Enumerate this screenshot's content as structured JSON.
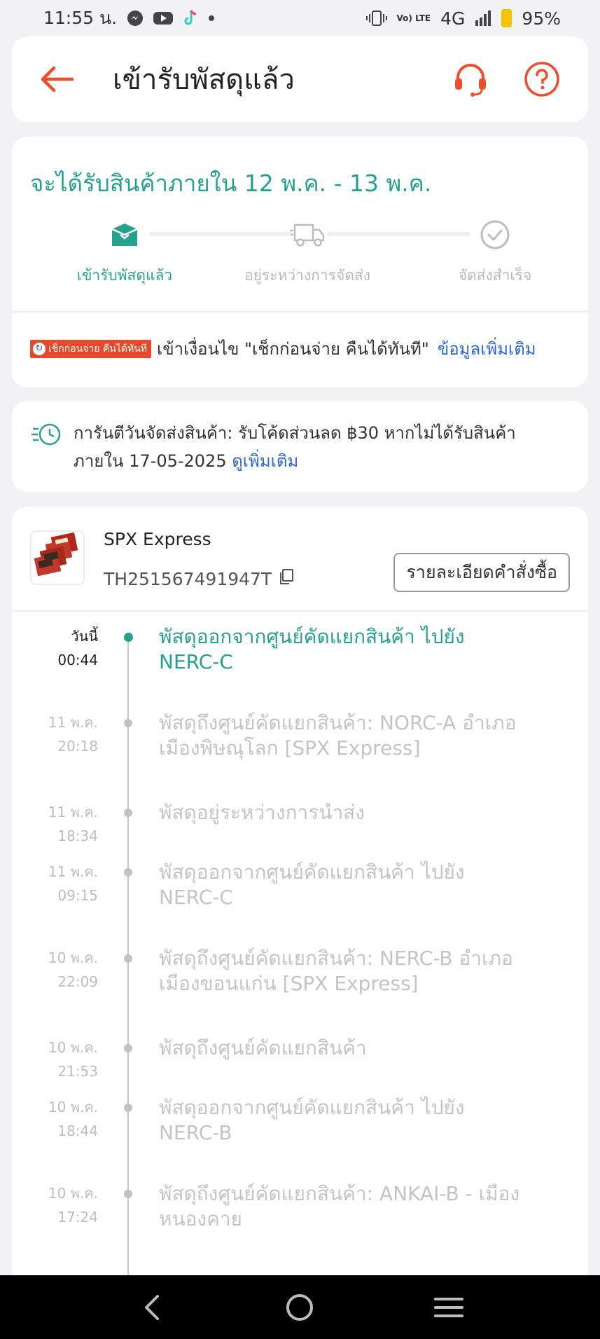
{
  "status_bar": {
    "time": "11:55 น.",
    "network": "4G",
    "battery": "95%",
    "volte": "Vo) LTE",
    "icons": [
      "messenger-icon",
      "youtube-icon",
      "tiktok-icon",
      "dot-icon",
      "vibrate-icon",
      "signal-icon",
      "battery-icon"
    ]
  },
  "header": {
    "title": "เข้ารับพัสดุแล้ว",
    "accent": "#ee4d2d"
  },
  "delivery": {
    "eta_prefix": "จะได้รับสินค้าภายใน ",
    "eta_range": "12 พ.ค. - 13 พ.ค.",
    "steps": [
      {
        "label": "เข้ารับพัสดุแล้ว",
        "icon": "box-icon",
        "active": true
      },
      {
        "label": "อยู่ระหว่างการจัดส่ง",
        "icon": "truck-icon",
        "active": false
      },
      {
        "label": "จัดส่งสำเร็จ",
        "icon": "check-circle-icon",
        "active": false
      }
    ],
    "promo_badge": "เช็กก่อนจ่าย คืนได้ทันที",
    "promo_text": "เข้าเงื่อนไข \"เช็กก่อนจ่าย คืนได้ทันที\"",
    "promo_link": "ข้อมูลเพิ่มเติม",
    "accent": "#26a28c"
  },
  "guarantee": {
    "text_line1": "การันตีวันจัดส่งสินค้า: รับโค้ดส่วนลด ฿30 หากไม่ได้รับสินค้า",
    "text_line2": "ภายใน 17-05-2025 ",
    "link": "ดูเพิ่มเติม"
  },
  "tracking": {
    "carrier": "SPX Express",
    "tracking_number": "TH251567491947T",
    "order_details_button": "รายละเอียดคำสั่งซื้อ",
    "events": [
      {
        "day": "วันนี้",
        "time": "00:44",
        "line1": "พัสดุออกจากศูนย์คัดแยกสินค้า ไปยัง",
        "line2": "NERC-C",
        "current": true
      },
      {
        "day": "11 พ.ค.",
        "time": "20:18",
        "line1": "พัสดุถึงศูนย์คัดแยกสินค้า: NORC-A อำเภอ",
        "line2": "เมืองพิษณุโลก [SPX Express]",
        "current": false
      },
      {
        "day": "11 พ.ค.",
        "time": "18:34",
        "line1": "พัสดุอยู่ระหว่างการนำส่ง",
        "line2": "",
        "current": false
      },
      {
        "day": "11 พ.ค.",
        "time": "09:15",
        "line1": "พัสดุออกจากศูนย์คัดแยกสินค้า ไปยัง",
        "line2": "NERC-C",
        "current": false
      },
      {
        "day": "10 พ.ค.",
        "time": "22:09",
        "line1": "พัสดุถึงศูนย์คัดแยกสินค้า: NERC-B อำเภอ",
        "line2": "เมืองขอนแก่น [SPX Express]",
        "current": false
      },
      {
        "day": "10 พ.ค.",
        "time": "21:53",
        "line1": "พัสดุถึงศูนย์คัดแยกสินค้า",
        "line2": "",
        "current": false
      },
      {
        "day": "10 พ.ค.",
        "time": "18:44",
        "line1": "พัสดุออกจากศูนย์คัดแยกสินค้า ไปยัง",
        "line2": "NERC-B",
        "current": false
      },
      {
        "day": "10 พ.ค.",
        "time": "17:24",
        "line1": "พัสดุถึงศูนย์คัดแยกสินค้า: ANKAI-B - เมือง",
        "line2": "หนองคาย",
        "current": false
      }
    ]
  },
  "nav_bar": {
    "buttons": [
      "back-nav-icon",
      "home-nav-icon",
      "recents-nav-icon"
    ]
  }
}
